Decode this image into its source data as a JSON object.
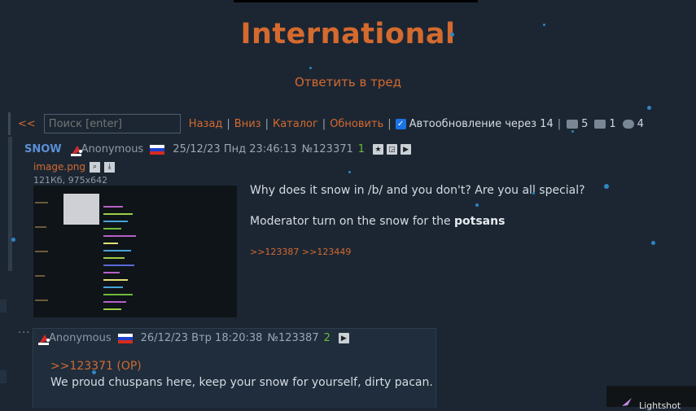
{
  "board": {
    "title": "International",
    "reply_link": "Ответить в тред"
  },
  "nav": {
    "back_arrows": "<<",
    "search_placeholder": "Поиск [enter]",
    "links": [
      "Назад",
      "Вниз",
      "Каталог",
      "Обновить"
    ],
    "autoupdate_label": "Автообновление через 14",
    "autoupdate_checked": true,
    "stats": {
      "posts": "5",
      "images": "1",
      "users": "4"
    }
  },
  "op": {
    "tag": "SNOW",
    "name": "Anonymous",
    "datetime": "25/12/23 Пнд 23:46:13",
    "number": "№123371",
    "count": "1",
    "file": {
      "name": "image.png",
      "info": "121Кб, 975x642"
    },
    "text": [
      "Why does it snow in /b/ and you don't? Are you all special?"
    ],
    "text2_prefix": "Moderator turn on the snow for the ",
    "text2_bold": "potsans",
    "replies": ">>123387 >>123449"
  },
  "reply": {
    "dots": "···",
    "name": "Anonymous",
    "datetime": "26/12/23 Втр 18:20:38",
    "number": "№123387",
    "count": "2",
    "quote": ">>123371 (OP)",
    "text": "We proud chuspans here, keep your snow for yourself, dirty pacan."
  },
  "lightshot": {
    "label": "Lightshot"
  },
  "colors": {
    "accent": "#d46a2e",
    "background": "#1c2633",
    "post_bg": "#1f2d3c",
    "snow_tag": "#5b8fd6",
    "count": "#6fba3b"
  }
}
